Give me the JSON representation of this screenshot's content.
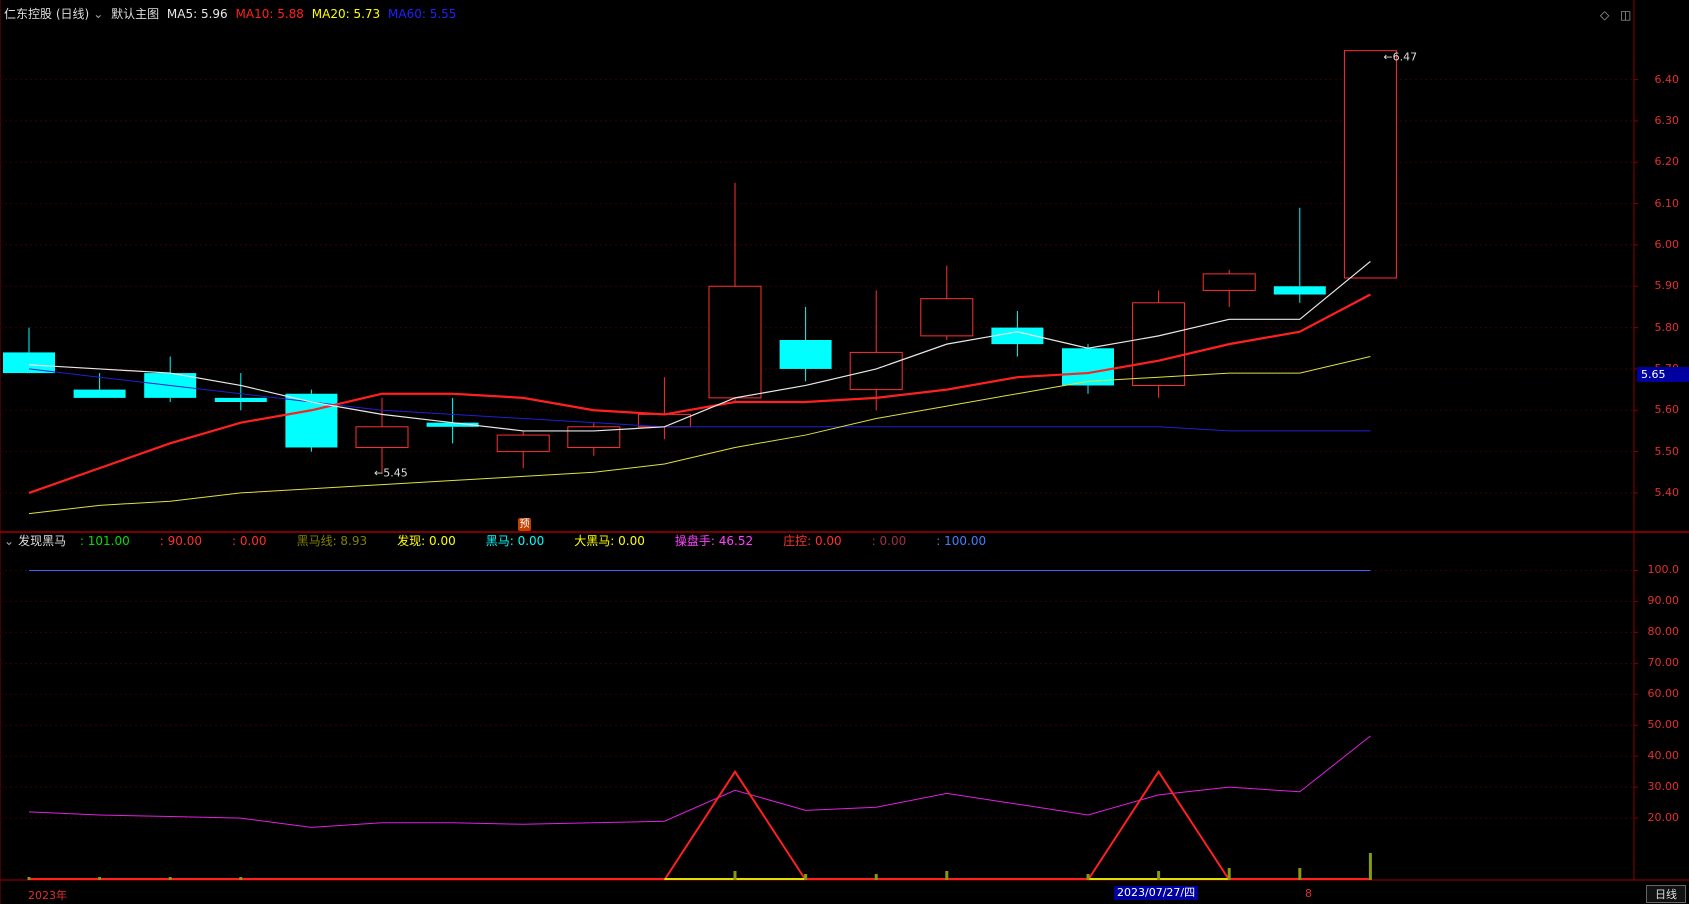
{
  "main_header": {
    "stock_name": "仁东控股 (日线)",
    "template_label": "默认主图",
    "ma5": "MA5: 5.96",
    "ma10": "MA10: 5.88",
    "ma20": "MA20: 5.73",
    "ma60": "MA60: 5.55"
  },
  "sub_header": {
    "indicator_name": "发现黑马",
    "items": [
      {
        "text": ": 101.00",
        "color": "#00e000"
      },
      {
        "text": ": 90.00",
        "color": "#ff3030"
      },
      {
        "text": ": 0.00",
        "color": "#ff3030"
      },
      {
        "text": "黑马线: 8.93",
        "color": "#808000"
      },
      {
        "text": "发现: 0.00",
        "color": "#ffff00"
      },
      {
        "text": "黑马: 0.00",
        "color": "#00ffff"
      },
      {
        "text": "大黑马: 0.00",
        "color": "#ffff00"
      },
      {
        "text": "操盘手: 46.52",
        "color": "#ff40ff"
      },
      {
        "text": "庄控: 0.00",
        "color": "#ff3030"
      },
      {
        "text": ": 0.00",
        "color": "#a03040"
      },
      {
        "text": ": 100.00",
        "color": "#4080ff"
      }
    ]
  },
  "price_axis": [
    "6.40",
    "6.30",
    "6.20",
    "6.10",
    "6.00",
    "5.90",
    "5.80",
    "5.70",
    "5.60",
    "5.50",
    "5.40"
  ],
  "current_price_tag": "5.65",
  "sub_axis": [
    "100.0",
    "90.00",
    "80.00",
    "70.00",
    "60.00",
    "50.00",
    "40.00",
    "30.00",
    "20.00"
  ],
  "annotations": {
    "high": "6.47",
    "low": "5.45",
    "yu_badge": "预"
  },
  "x_axis": {
    "year_label": "2023年",
    "date_cursor": "2023/07/27/四",
    "tick_8": "8"
  },
  "period_button": "日线",
  "colors": {
    "up": "#ff3030",
    "down": "#00ffff",
    "ma5": "#e8e8e8",
    "ma10": "#ff2020",
    "ma20": "#e0e040",
    "ma60": "#2020d0",
    "trader": "#e020e0",
    "horse": "#ff2020"
  },
  "chart_data": {
    "type": "candlestick",
    "candles": [
      {
        "o": 5.74,
        "h": 5.8,
        "l": 5.7,
        "c": 5.69
      },
      {
        "o": 5.65,
        "h": 5.69,
        "l": 5.63,
        "c": 5.63
      },
      {
        "o": 5.69,
        "h": 5.73,
        "l": 5.62,
        "c": 5.63
      },
      {
        "o": 5.63,
        "h": 5.69,
        "l": 5.6,
        "c": 5.62
      },
      {
        "o": 5.64,
        "h": 5.65,
        "l": 5.5,
        "c": 5.51
      },
      {
        "o": 5.51,
        "h": 5.63,
        "l": 5.45,
        "c": 5.56
      },
      {
        "o": 5.57,
        "h": 5.63,
        "l": 5.52,
        "c": 5.56
      },
      {
        "o": 5.5,
        "h": 5.55,
        "l": 5.46,
        "c": 5.54
      },
      {
        "o": 5.51,
        "h": 5.57,
        "l": 5.49,
        "c": 5.56
      },
      {
        "o": 5.56,
        "h": 5.68,
        "l": 5.53,
        "c": 5.59
      },
      {
        "o": 5.63,
        "h": 6.15,
        "l": 5.62,
        "c": 5.9
      },
      {
        "o": 5.77,
        "h": 5.85,
        "l": 5.67,
        "c": 5.7
      },
      {
        "o": 5.65,
        "h": 5.89,
        "l": 5.6,
        "c": 5.74
      },
      {
        "o": 5.78,
        "h": 5.95,
        "l": 5.77,
        "c": 5.87
      },
      {
        "o": 5.8,
        "h": 5.84,
        "l": 5.73,
        "c": 5.76
      },
      {
        "o": 5.75,
        "h": 5.76,
        "l": 5.64,
        "c": 5.66
      },
      {
        "o": 5.66,
        "h": 5.89,
        "l": 5.63,
        "c": 5.86
      },
      {
        "o": 5.89,
        "h": 5.94,
        "l": 5.85,
        "c": 5.93
      },
      {
        "o": 5.9,
        "h": 6.09,
        "l": 5.86,
        "c": 5.88
      },
      {
        "o": 5.92,
        "h": 6.47,
        "l": 5.92,
        "c": 6.47
      }
    ],
    "ma5": [
      5.71,
      5.7,
      5.69,
      5.66,
      5.62,
      5.59,
      5.57,
      5.55,
      5.55,
      5.56,
      5.63,
      5.66,
      5.7,
      5.76,
      5.79,
      5.75,
      5.78,
      5.82,
      5.82,
      5.96
    ],
    "ma10": [
      5.4,
      5.46,
      5.52,
      5.57,
      5.6,
      5.64,
      5.64,
      5.63,
      5.6,
      5.59,
      5.62,
      5.62,
      5.63,
      5.65,
      5.68,
      5.69,
      5.72,
      5.76,
      5.79,
      5.88
    ],
    "ma20": [
      5.35,
      5.37,
      5.38,
      5.4,
      5.41,
      5.42,
      5.43,
      5.44,
      5.45,
      5.47,
      5.51,
      5.54,
      5.58,
      5.61,
      5.64,
      5.67,
      5.68,
      5.69,
      5.69,
      5.73
    ],
    "ma60": [
      5.7,
      5.68,
      5.66,
      5.64,
      5.62,
      5.6,
      5.59,
      5.58,
      5.57,
      5.56,
      5.56,
      5.56,
      5.56,
      5.56,
      5.56,
      5.56,
      5.56,
      5.55,
      5.55,
      5.55
    ],
    "ylim": [
      5.32,
      6.52
    ],
    "sub": {
      "trader": [
        22,
        21,
        20.5,
        20,
        17,
        18.5,
        18.5,
        18,
        18.5,
        19,
        29,
        22.5,
        23.5,
        28,
        24.5,
        21,
        27.5,
        30,
        28.5,
        46.52
      ],
      "line100": 100,
      "triangles": [
        {
          "start": 9,
          "peak": 10,
          "end": 11,
          "height": 35
        },
        {
          "start": 15,
          "peak": 16,
          "end": 17,
          "height": 35
        }
      ],
      "volume_ticks": [
        1,
        1,
        1,
        1,
        0,
        0,
        0,
        0,
        0,
        0,
        3,
        2,
        2,
        3,
        0,
        2,
        3,
        4,
        4,
        9
      ],
      "ylim": [
        0,
        105
      ]
    }
  }
}
